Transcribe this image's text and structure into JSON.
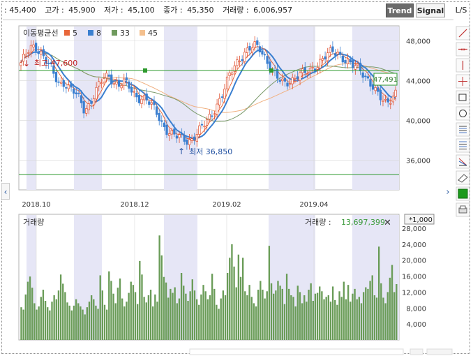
{
  "quote_bar": {
    "current": ": 45,400",
    "high_label": "고가 :",
    "high": "45,900",
    "low_label": "저가 :",
    "low": "45,100",
    "close_label": "종가 :",
    "close": "45,350",
    "volume_label": "거래량 :",
    "volume": "6,006,957"
  },
  "mode_buttons": {
    "trend": "Trend",
    "signal": "Signal",
    "ls": "L/S"
  },
  "price_panel": {
    "legend_title": "이동평균선",
    "ma_legend": [
      {
        "period": "5",
        "color": "#e8673a"
      },
      {
        "period": "8",
        "color": "#3a7fd0"
      },
      {
        "period": "33",
        "color": "#6f9a5e"
      },
      {
        "period": "45",
        "color": "#f4c08e"
      }
    ],
    "high_marker": "최고 47,600",
    "low_marker": "최저 36,850",
    "last_price_tag": "47,491",
    "y_ticks": [
      "48,000",
      "44,000",
      "40,000",
      "36,000"
    ],
    "x_ticks": [
      "2018.10",
      "2018.12",
      "2019.02",
      "2019.04"
    ]
  },
  "volume_panel": {
    "title": "거래량",
    "readout_label": "거래량 :",
    "readout_value": "13,697,399",
    "close_symbol": "✕",
    "unit_badge": "*1,000",
    "y_ticks": [
      "28,000",
      "24,000",
      "20,000",
      "16,000",
      "12,000",
      "8,000",
      "4,000"
    ]
  },
  "colors": {
    "up": "#e05030",
    "down": "#3a7fd0",
    "ma5": "#e8673a",
    "ma8": "#3a7fd0",
    "ma33": "#7a9a6a",
    "ma45": "#f0b080",
    "volume_bar": "#6a9c58",
    "shade": "#e6e6f6",
    "hline": "#2e9a2e"
  },
  "toolbar_icons": [
    "trend-line-icon",
    "horizontal-line-icon",
    "vertical-line-icon",
    "crosshair-icon",
    "rectangle-icon",
    "circle-icon",
    "fibonacci-icon",
    "fibonacci-fan-icon",
    "gann-line-icon",
    "eraser-icon",
    "color-picker-icon",
    "print-icon"
  ],
  "chart_data": [
    {
      "type": "candlestick",
      "title": "",
      "x_ticks": [
        "2018.10",
        "2018.12",
        "2019.02",
        "2019.04"
      ],
      "ylim": [
        33000,
        49500
      ],
      "y_ticks": [
        48000,
        44000,
        40000,
        36000
      ],
      "high": 47600,
      "low": 36850,
      "last": 47491,
      "horizontal_lines": [
        47600,
        33800
      ],
      "series": [
        {
          "name": "5",
          "role": "moving-average"
        },
        {
          "name": "8",
          "role": "moving-average"
        },
        {
          "name": "33",
          "role": "moving-average"
        },
        {
          "name": "45",
          "role": "moving-average"
        }
      ],
      "close_path": [
        45800,
        46500,
        47200,
        47400,
        47000,
        46200,
        45300,
        44200,
        43600,
        43900,
        43300,
        42800,
        42000,
        41000,
        41600,
        42600,
        43500,
        44100,
        44400,
        44000,
        43600,
        43900,
        43400,
        42700,
        42300,
        42400,
        42000,
        41300,
        40600,
        39700,
        39100,
        38600,
        38300,
        38200,
        38000,
        38100,
        38600,
        39100,
        39700,
        40500,
        41400,
        42200,
        43300,
        44600,
        45600,
        46300,
        46800,
        47100,
        47400,
        47300,
        46600,
        45600,
        44600,
        44000,
        43700,
        44000,
        44200,
        44500,
        44600,
        44900,
        45300,
        45700,
        46100,
        46500,
        46900,
        46900,
        46400,
        45900,
        45400,
        45300,
        45000,
        44400,
        43600,
        42700,
        42100,
        41800,
        42300,
        42800
      ]
    },
    {
      "type": "bar",
      "title": "거래량",
      "unit": "*1,000",
      "ylim": [
        0,
        28000
      ],
      "y_ticks": [
        28000,
        24000,
        20000,
        16000,
        12000,
        8000,
        4000
      ],
      "last_value": 13697399,
      "values": [
        8200,
        7600,
        11400,
        14600,
        15900,
        13100,
        9200,
        7600,
        8400,
        10800,
        12600,
        9800,
        8200,
        7400,
        9600,
        11200,
        10200,
        12400,
        16400,
        14100,
        12000,
        9400,
        8600,
        7400,
        8600,
        10200,
        9200,
        8400,
        7600,
        6400,
        8200,
        9600,
        11200,
        10200,
        8600,
        7800,
        16200,
        12400,
        8800,
        7600,
        17200,
        14800,
        11600,
        9200,
        13100,
        15400,
        10400,
        8400,
        9600,
        11800,
        14600,
        13800,
        12000,
        9000,
        19800,
        16400,
        10800,
        9400,
        11200,
        12600,
        8400,
        11400,
        9600,
        26200,
        21200,
        15800,
        14400,
        10600,
        12800,
        11800,
        13200,
        9200,
        10400,
        16800,
        13600,
        11600,
        9800,
        12200,
        15200,
        12400,
        10200,
        8800,
        11400,
        13800,
        12200,
        10200,
        11200,
        16600,
        12800,
        8800,
        7800,
        10400,
        12400,
        11200,
        16800,
        20600,
        24000,
        18400,
        13200,
        21400,
        15800,
        20600,
        12200,
        11200,
        13800,
        10800,
        9200,
        8400,
        12600,
        14800,
        12600,
        10400,
        12200,
        23600,
        14200,
        11600,
        12400,
        14800,
        13600,
        12800,
        9000,
        16600,
        12800,
        11200,
        10800,
        8400,
        13600,
        12000,
        9200,
        11200,
        9600,
        12600,
        14200,
        9800,
        11600,
        11800,
        13400,
        12200,
        10200,
        10800,
        11200,
        9600,
        13400,
        10000,
        8800,
        12200,
        10800,
        14600,
        10200,
        13800,
        9600,
        11600,
        12800,
        10200,
        10800,
        9200,
        12000,
        13200,
        12800,
        14800,
        16200,
        11200,
        10600,
        23400,
        14200,
        10600,
        9200,
        12000,
        15600,
        18800,
        12000,
        14000
      ]
    }
  ]
}
